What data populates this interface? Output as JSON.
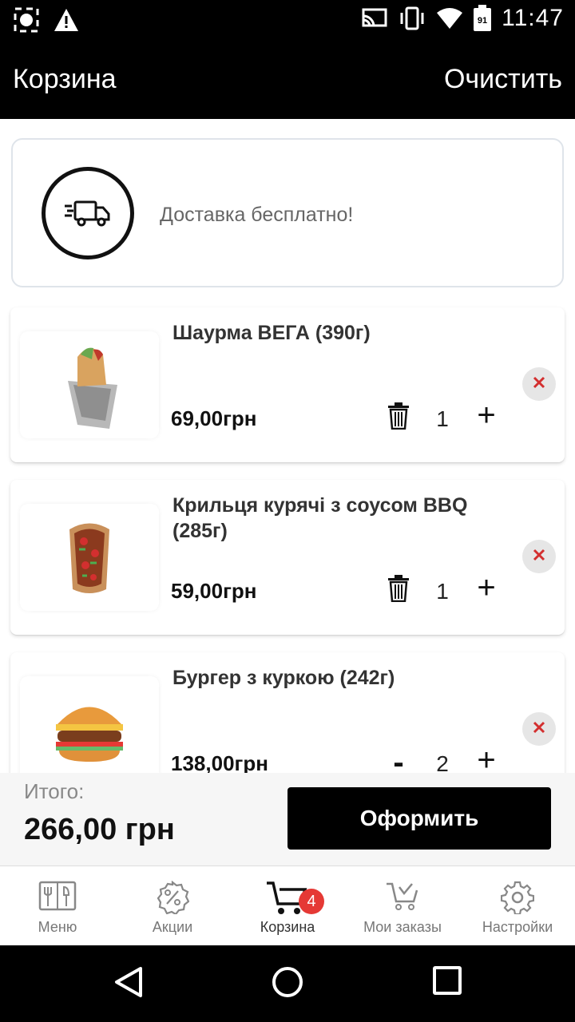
{
  "status_bar": {
    "time": "11:47",
    "battery_level": "91"
  },
  "header": {
    "title": "Корзина",
    "clear_label": "Очистить"
  },
  "delivery": {
    "text": "Доставка бесплатно!"
  },
  "cart_items": [
    {
      "name": "Шаурма ВЕГА (390г)",
      "price": "69,00грн",
      "quantity": "1",
      "qty_control": "trash"
    },
    {
      "name": "Крильця курячі з соусом BBQ (285г)",
      "price": "59,00грн",
      "quantity": "1",
      "qty_control": "trash"
    },
    {
      "name": "Бургер з куркою (242г)",
      "price": "138,00грн",
      "quantity": "2",
      "qty_control": "minus",
      "minus_label": "-"
    }
  ],
  "summary": {
    "label": "Итого:",
    "total": "266,00 грн",
    "checkout_label": "Оформить"
  },
  "bottom_nav": [
    {
      "label": "Меню",
      "icon": "menu-book-icon"
    },
    {
      "label": "Акции",
      "icon": "percent-badge-icon"
    },
    {
      "label": "Корзина",
      "icon": "cart-icon",
      "badge": "4",
      "active": true
    },
    {
      "label": "Мои заказы",
      "icon": "cart-orders-icon"
    },
    {
      "label": "Настройки",
      "icon": "gear-icon"
    }
  ],
  "colors": {
    "accent": "#000000",
    "badge": "#e53935",
    "remove": "#d32f2f"
  }
}
